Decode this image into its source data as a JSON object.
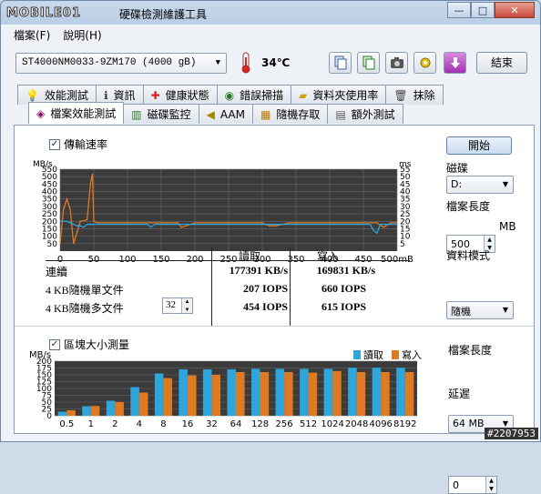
{
  "window": {
    "logo_text": "MOBILE01",
    "title": "硬碟檢測維護工具",
    "controls": {
      "minimize": "—",
      "maximize": "□",
      "close": "✕"
    }
  },
  "menu": [
    {
      "label": "檔案(F)"
    },
    {
      "label": "說明(H)"
    }
  ],
  "toolbar": {
    "drive": "ST4000NM0033-9ZM170 (4000 gB)",
    "temperature": "34℃",
    "end_label": "結束"
  },
  "tabs_row1": [
    {
      "label": "效能測試",
      "icon": "bulb-icon"
    },
    {
      "label": "資訊",
      "icon": "info-icon"
    },
    {
      "label": "健康狀態",
      "icon": "health-cross-icon"
    },
    {
      "label": "錯誤掃描",
      "icon": "scan-icon"
    },
    {
      "label": "資料夾使用率",
      "icon": "folder-icon"
    },
    {
      "label": "抹除",
      "icon": "trash-icon"
    }
  ],
  "tabs_row2": [
    {
      "label": "檔案效能測試",
      "icon": "file-bench-icon",
      "active": true
    },
    {
      "label": "磁碟監控",
      "icon": "monitor-icon"
    },
    {
      "label": "AAM",
      "icon": "speaker-icon"
    },
    {
      "label": "隨機存取",
      "icon": "random-icon"
    },
    {
      "label": "額外測試",
      "icon": "extra-icon"
    }
  ],
  "transfer": {
    "checkbox_label": "傳輸速率",
    "checked": true,
    "start_label": "開始"
  },
  "results": {
    "col_read": "讀取",
    "col_write": "寫入",
    "rows": [
      {
        "label": "連續",
        "read": "177391 KB/s",
        "write": "169831 KB/s"
      },
      {
        "label": "4 KB隨機單文件",
        "read": "207 IOPS",
        "write": "660 IOPS"
      },
      {
        "label": "4 KB隨機多文件",
        "queue": "32",
        "read": "454 IOPS",
        "write": "615 IOPS"
      }
    ]
  },
  "right_panel": {
    "disk_label": "磁碟",
    "disk_value": "D:",
    "file_len_label": "檔案長度",
    "file_len_value": "500",
    "file_len_unit": "MB",
    "data_mode_label": "資料模式",
    "data_mode_value": "隨機"
  },
  "block": {
    "checkbox_label": "區塊大小測量",
    "checked": true,
    "file_len_label": "檔案長度",
    "file_len_value": "64 MB",
    "delay_label": "延遲",
    "delay_value": "0"
  },
  "watermark": "#2207953",
  "colors": {
    "read": "#2ea6dc",
    "write": "#e07a22",
    "chart_bg": "#3b3b3b",
    "grid": "#6b6b6b"
  },
  "chart_data": [
    {
      "type": "line",
      "title": "",
      "ylabel_left": "MB/s",
      "ylabel_right": "ms",
      "xunit": "mB",
      "xlim": [
        0,
        500
      ],
      "ylim": [
        0,
        55
      ],
      "y_left_ticks": [
        50,
        100,
        150,
        200,
        250,
        300,
        350,
        400,
        450,
        500,
        550
      ],
      "y_right_ticks": [
        5,
        10,
        15,
        20,
        25,
        30,
        35,
        40,
        45,
        50,
        55
      ],
      "x_ticks": [
        0,
        50,
        100,
        150,
        200,
        250,
        300,
        350,
        400,
        450,
        "500mB"
      ],
      "series": [
        {
          "name": "",
          "color": "#e07a22",
          "x": [
            0,
            5,
            10,
            15,
            20,
            30,
            40,
            45,
            48,
            50,
            55,
            60,
            80,
            100,
            150,
            175,
            180,
            200,
            210,
            250,
            300,
            310,
            320,
            340,
            350,
            400,
            450,
            470,
            480,
            490,
            500
          ],
          "y": [
            5,
            28,
            35,
            28,
            5,
            20,
            21,
            45,
            52,
            20,
            19,
            19,
            19,
            19,
            19,
            19,
            16,
            19,
            19,
            19,
            19,
            17,
            17,
            19,
            19,
            19,
            19,
            19,
            16,
            19,
            19
          ]
        },
        {
          "name": "",
          "color": "#2ea6dc",
          "x": [
            0,
            10,
            20,
            25,
            30,
            35,
            40,
            50,
            55,
            60,
            100,
            130,
            135,
            140,
            150,
            160,
            200,
            250,
            300,
            350,
            360,
            400,
            420,
            460,
            465,
            470,
            475,
            480,
            500
          ],
          "y": [
            20,
            20,
            18,
            17,
            17,
            16,
            18,
            18,
            18,
            18,
            18,
            18,
            16,
            18,
            18,
            18,
            18,
            18,
            18,
            18,
            18,
            18,
            18,
            18,
            14,
            12,
            18,
            18,
            18
          ]
        }
      ]
    },
    {
      "type": "bar",
      "title": "",
      "ylabel": "MB/s",
      "ylim": [
        0,
        200
      ],
      "y_ticks": [
        0,
        25,
        50,
        75,
        100,
        125,
        150,
        175,
        200
      ],
      "categories": [
        "0.5",
        "1",
        "2",
        "4",
        "8",
        "16",
        "32",
        "64",
        "128",
        "256",
        "512",
        "1024",
        "2048",
        "4096",
        "8192"
      ],
      "series": [
        {
          "name": "讀取",
          "color": "#2ea6dc",
          "values": [
            15,
            35,
            55,
            105,
            155,
            170,
            170,
            170,
            172,
            172,
            172,
            172,
            176,
            176,
            176
          ]
        },
        {
          "name": "寫入",
          "color": "#e07a22",
          "values": [
            20,
            36,
            50,
            85,
            138,
            148,
            150,
            160,
            160,
            160,
            158,
            164,
            160,
            160,
            160
          ]
        }
      ]
    }
  ]
}
